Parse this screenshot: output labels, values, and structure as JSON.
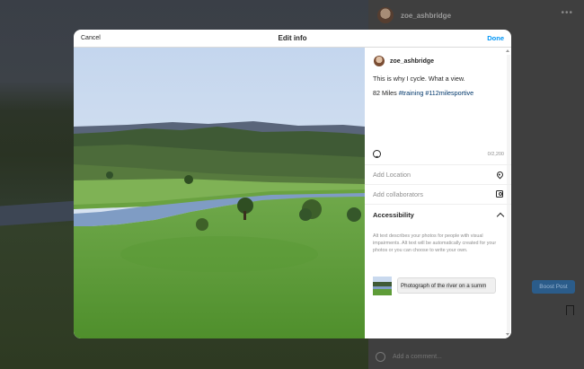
{
  "background_post": {
    "username": "zoe_ashbridge",
    "more_icon": "more-horizontal-icon",
    "boost_label": "Boost Post",
    "comment_placeholder": "Add a comment..."
  },
  "modal": {
    "cancel_label": "Cancel",
    "title": "Edit info",
    "done_label": "Done",
    "accent_color": "#0095f6"
  },
  "post": {
    "username": "zoe_ashbridge",
    "caption_line1": "This is why I cycle. What a view.",
    "caption_line2_prefix": "82 Miles ",
    "hashtag1": "#training",
    "hashtag2": "#112milesportive",
    "char_count": "0/2,200"
  },
  "options": {
    "add_location": "Add Location",
    "add_collaborators": "Add collaborators"
  },
  "accessibility": {
    "title": "Accessibility",
    "description": "Alt text describes your photos for people with visual impairments. Alt text will be automatically created for your photos or you can choose to write your own.",
    "alt_text_value": "Photograph of the river on a summ"
  }
}
